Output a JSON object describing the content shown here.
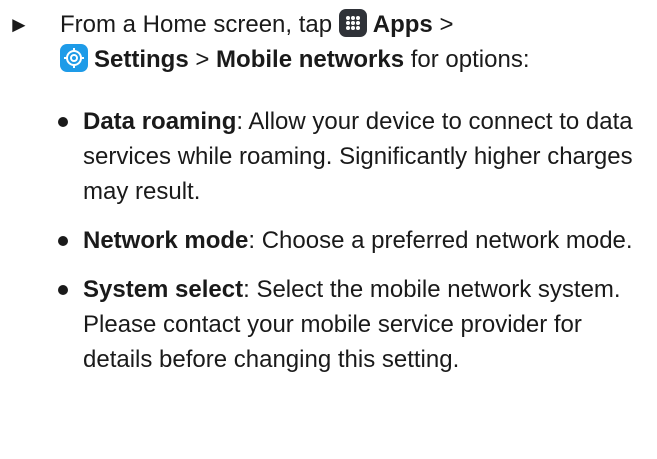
{
  "step": {
    "prefix": "From a Home screen, tap",
    "apps_label": "Apps",
    "sep1": ">",
    "settings_label": "Settings",
    "sep2": ">",
    "mobile_networks_label": "Mobile networks",
    "suffix": "for options:",
    "icons": [
      "apps-icon",
      "settings-icon"
    ]
  },
  "bullets": [
    {
      "term": "Data roaming",
      "text": ": Allow your device to connect to data services while roaming. Significantly higher charges may result."
    },
    {
      "term": "Network mode",
      "text": ": Choose a preferred network mode."
    },
    {
      "term": "System select",
      "text": ": Select the mobile network system. Please contact your mobile service provider for details before changing this setting."
    }
  ],
  "colors": {
    "text": "#1a1a1a",
    "apps_icon_bg": "#2f3238",
    "settings_icon_bg": "#1e9be8"
  }
}
